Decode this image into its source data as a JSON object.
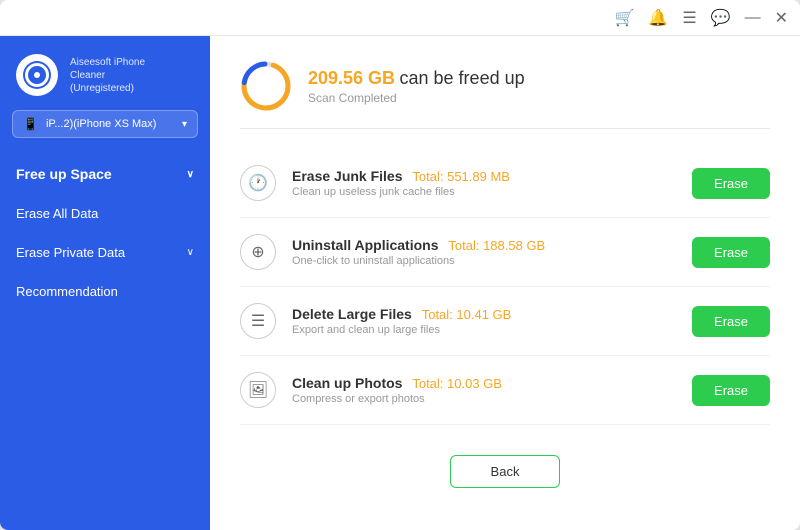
{
  "app": {
    "name": "Aiseesoft iPhone",
    "name_line2": "Cleaner",
    "status": "(Unregistered)"
  },
  "titlebar": {
    "icons": [
      "cart",
      "bell",
      "menu",
      "chat",
      "minimize",
      "close"
    ]
  },
  "device": {
    "label": "iP...2)(iPhone XS Max)"
  },
  "nav": {
    "items": [
      {
        "label": "Free up Space",
        "active": true,
        "has_chevron": true
      },
      {
        "label": "Erase All Data",
        "active": false,
        "has_chevron": false
      },
      {
        "label": "Erase Private Data",
        "active": false,
        "has_chevron": true
      },
      {
        "label": "Recommendation",
        "active": false,
        "has_chevron": false
      }
    ]
  },
  "scan": {
    "amount": "209.56 GB",
    "label": " can be freed up",
    "sub": "Scan Completed"
  },
  "features": [
    {
      "title": "Erase Junk Files",
      "total_label": "Total: 551.89 MB",
      "desc": "Clean up useless junk cache files",
      "icon": "clock",
      "btn": "Erase"
    },
    {
      "title": "Uninstall Applications",
      "total_label": "Total: 188.58 GB",
      "desc": "One-click to uninstall applications",
      "icon": "star-circle",
      "btn": "Erase"
    },
    {
      "title": "Delete Large Files",
      "total_label": "Total: 10.41 GB",
      "desc": "Export and clean up large files",
      "icon": "file",
      "btn": "Erase"
    },
    {
      "title": "Clean up Photos",
      "total_label": "Total: 10.03 GB",
      "desc": "Compress or export photos",
      "icon": "image",
      "btn": "Erase"
    }
  ],
  "back_btn": "Back"
}
